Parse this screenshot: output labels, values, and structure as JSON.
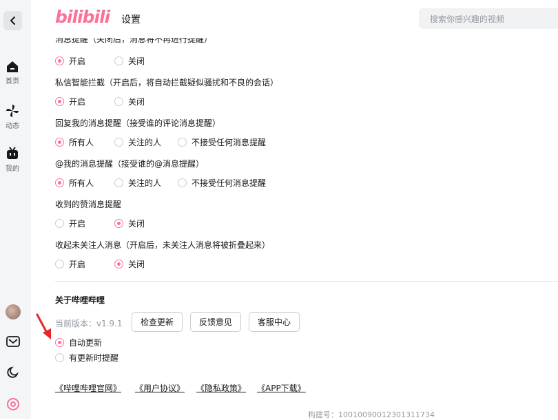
{
  "header": {
    "logo": "bilibili",
    "title": "设置",
    "search_placeholder": "搜索你感兴趣的视频"
  },
  "sidebar": {
    "items": [
      {
        "label": "首页",
        "icon": "home-icon"
      },
      {
        "label": "动态",
        "icon": "pinwheel-icon"
      },
      {
        "label": "我的",
        "icon": "tv-icon"
      }
    ],
    "bottom_icons": [
      "avatar",
      "mail-icon",
      "moon-icon",
      "settings-icon"
    ]
  },
  "settings": {
    "clipped_top_label": "消息提醒（关闭后，消息将不再进行提醒）",
    "groups": [
      {
        "label": "",
        "options": [
          "开启",
          "关闭"
        ],
        "selected": 0
      },
      {
        "label": "私信智能拦截（开启后，将自动拦截疑似骚扰和不良的会话）",
        "options": [
          "开启",
          "关闭"
        ],
        "selected": 0
      },
      {
        "label": "回复我的消息提醒（接受谁的评论消息提醒）",
        "options": [
          "所有人",
          "关注的人",
          "不接受任何消息提醒"
        ],
        "selected": 0
      },
      {
        "label": "@我的消息提醒（接受谁的@消息提醒）",
        "options": [
          "所有人",
          "关注的人",
          "不接受任何消息提醒"
        ],
        "selected": 0
      },
      {
        "label": "收到的赞消息提醒",
        "options": [
          "开启",
          "关闭"
        ],
        "selected": 1
      },
      {
        "label": "收起未关注人消息（开启后，未关注人消息将被折叠起来）",
        "options": [
          "开启",
          "关闭"
        ],
        "selected": 1
      }
    ]
  },
  "about": {
    "title": "关于哔哩哔哩",
    "version": "当前版本：v1.9.1",
    "buttons": [
      "检查更新",
      "反馈意见",
      "客服中心"
    ],
    "update_options": [
      "自动更新",
      "有更新时提醒"
    ],
    "update_selected": 0,
    "links": [
      "《哔哩哔哩官网》",
      "《用户协议》",
      "《隐私政策》",
      "《APP下载》"
    ],
    "build": "构建号：10010090012301311734"
  },
  "colors": {
    "accent": "#fb7299",
    "arrow": "#e8262a"
  }
}
